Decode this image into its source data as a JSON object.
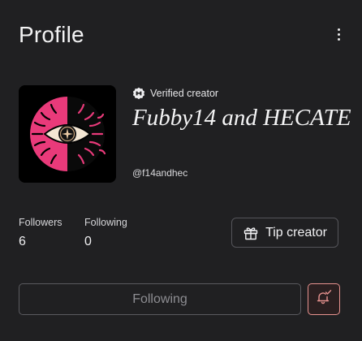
{
  "header": {
    "title": "Profile",
    "menu_icon": "more-vertical-icon"
  },
  "profile": {
    "avatar_description_icon": "eye-artwork-icon",
    "verified_label": "Verified creator",
    "verified_icon": "verified-badge-icon",
    "display_name": "Fubby14 and HECATE",
    "handle": "@f14andhec"
  },
  "stats": {
    "followers_label": "Followers",
    "followers_value": "6",
    "following_label": "Following",
    "following_value": "0"
  },
  "actions": {
    "tip_label": "Tip creator",
    "tip_icon": "gift-icon",
    "following_label": "Following",
    "bell_icon": "bell-check-icon"
  },
  "colors": {
    "background": "#202022",
    "accent_pink": "#e93a7a",
    "bell_border": "#e7928f"
  }
}
